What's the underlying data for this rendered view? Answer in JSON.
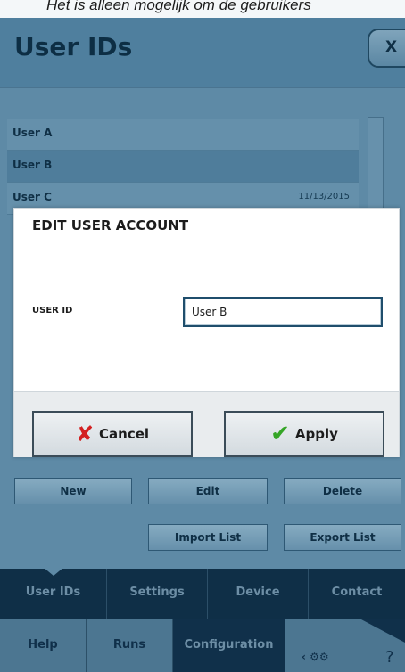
{
  "top_strip": {
    "text": "Het is alleen mogelijk om de gebruikers"
  },
  "header": {
    "title": "User IDs",
    "close_label": "X"
  },
  "users": [
    {
      "name": "User A",
      "date": ""
    },
    {
      "name": "User B",
      "date": ""
    },
    {
      "name": "User C",
      "date": "11/13/2015"
    }
  ],
  "actions": {
    "new_label": "New",
    "edit_label": "Edit",
    "delete_label": "Delete",
    "import_label": "Import List",
    "export_label": "Export List"
  },
  "nav": {
    "items": [
      {
        "label": "User IDs"
      },
      {
        "label": "Settings"
      },
      {
        "label": "Device"
      },
      {
        "label": "Contact"
      }
    ]
  },
  "footer": {
    "tabs": [
      {
        "label": "Help"
      },
      {
        "label": "Runs"
      },
      {
        "label": "Configuration"
      }
    ],
    "tools_icon": "gears-icon",
    "help_symbol": "?"
  },
  "modal": {
    "title": "EDIT USER ACCOUNT",
    "field_label": "USER ID",
    "field_value": "User B",
    "cancel_label": "Cancel",
    "apply_label": "Apply"
  },
  "colors": {
    "accent_dark": "#0f2f47",
    "cancel_red": "#d32020",
    "apply_green": "#35a526"
  }
}
